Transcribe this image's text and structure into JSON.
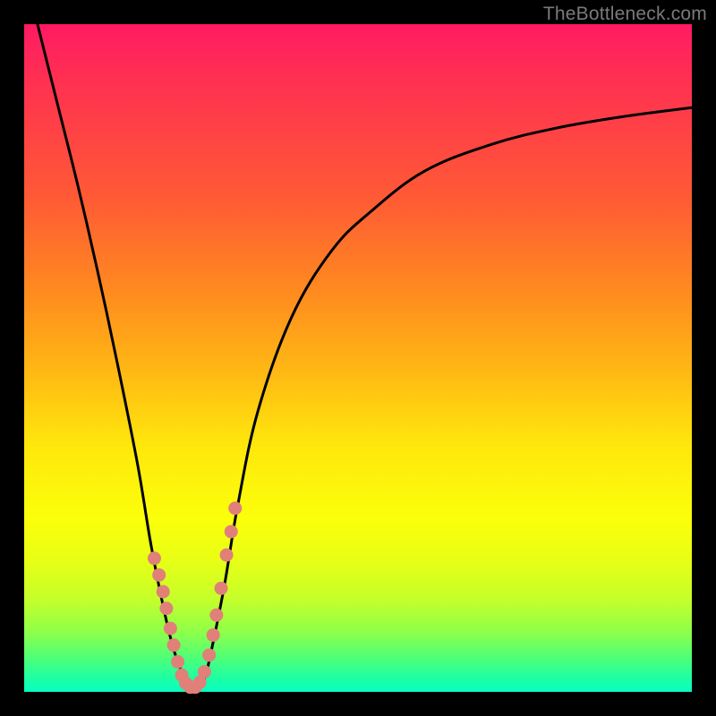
{
  "watermark": "TheBottleneck.com",
  "colors": {
    "curve_stroke": "#000000",
    "dot_fill": "#e08078",
    "frame_bg": "#000000"
  },
  "chart_data": {
    "type": "line",
    "title": "",
    "xlabel": "",
    "ylabel": "",
    "xlim": [
      0,
      100
    ],
    "ylim": [
      0,
      100
    ],
    "series": [
      {
        "name": "bottleneck-curve",
        "x": [
          2,
          5,
          8,
          11,
          14,
          17,
          19,
          21,
          22.5,
          24,
          25,
          26,
          27,
          28,
          30,
          32,
          35,
          40,
          46,
          52,
          60,
          70,
          80,
          90,
          100
        ],
        "y": [
          100,
          88,
          76,
          63,
          49,
          34,
          22,
          12,
          6,
          2,
          0.5,
          0.5,
          2,
          6,
          16,
          28,
          42,
          56,
          66,
          72,
          78,
          82,
          84.5,
          86.2,
          87.5
        ]
      }
    ],
    "dots": {
      "name": "highlighted-points",
      "x": [
        19.5,
        20.2,
        20.8,
        21.3,
        21.9,
        22.4,
        23.0,
        23.6,
        24.2,
        24.9,
        25.6,
        26.3,
        27.0,
        27.7,
        28.3,
        28.8,
        29.5,
        30.3,
        31.0,
        31.6
      ],
      "y": [
        20.0,
        17.5,
        15.0,
        12.5,
        9.5,
        7.0,
        4.5,
        2.5,
        1.3,
        0.7,
        0.7,
        1.4,
        3.0,
        5.5,
        8.5,
        11.5,
        15.5,
        20.5,
        24.0,
        27.5
      ]
    }
  }
}
